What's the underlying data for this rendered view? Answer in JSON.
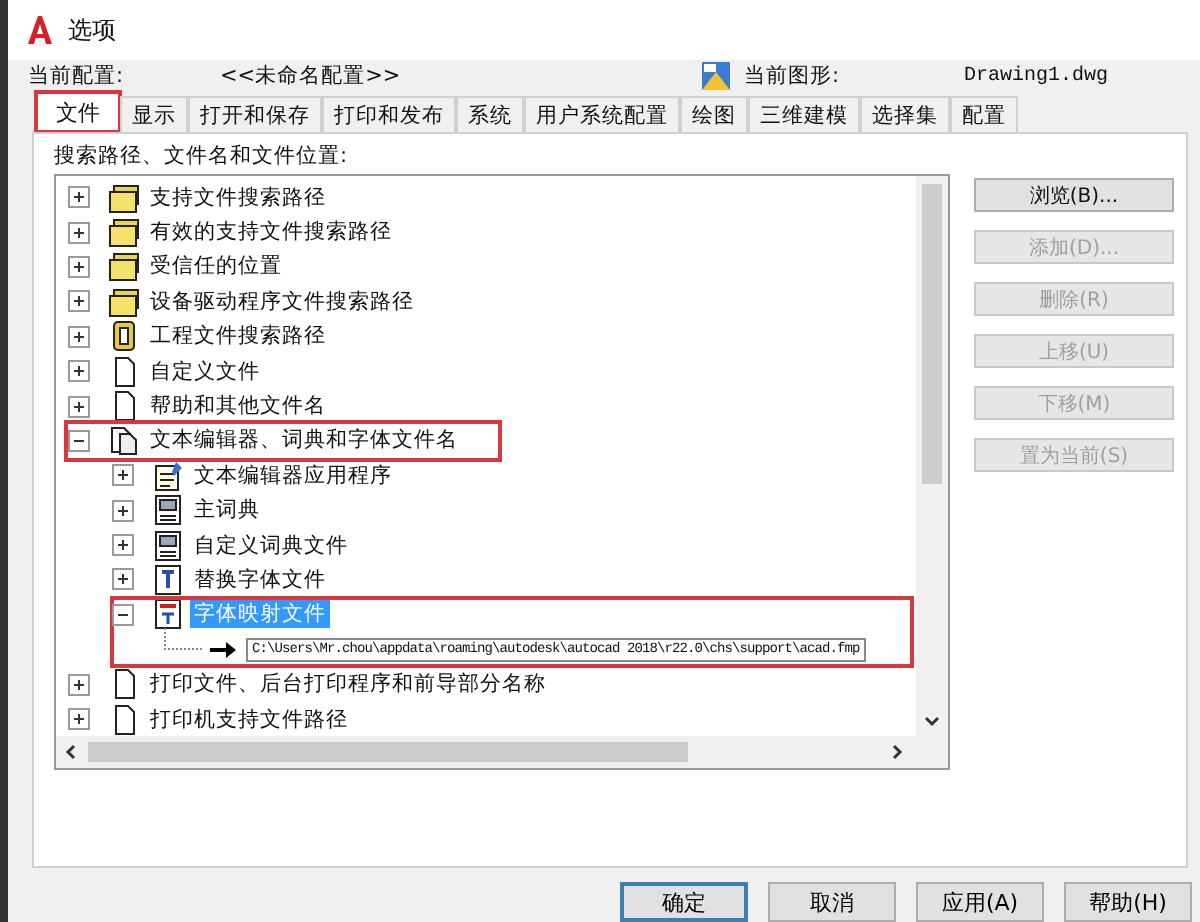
{
  "window": {
    "title": "选项"
  },
  "profile": {
    "label": "当前配置:",
    "value": "<<未命名配置>>",
    "drawing_label": "当前图形:",
    "drawing_value": "Drawing1.dwg"
  },
  "tabs": [
    {
      "label": "文件",
      "selected": true,
      "highlighted": true
    },
    {
      "label": "显示",
      "selected": false,
      "highlighted": false
    },
    {
      "label": "打开和保存",
      "selected": false,
      "highlighted": false
    },
    {
      "label": "打印和发布",
      "selected": false,
      "highlighted": false
    },
    {
      "label": "系统",
      "selected": false,
      "highlighted": false
    },
    {
      "label": "用户系统配置",
      "selected": false,
      "highlighted": false
    },
    {
      "label": "绘图",
      "selected": false,
      "highlighted": false
    },
    {
      "label": "三维建模",
      "selected": false,
      "highlighted": false
    },
    {
      "label": "选择集",
      "selected": false,
      "highlighted": false
    },
    {
      "label": "配置",
      "selected": false,
      "highlighted": false
    }
  ],
  "tree_label": "搜索路径、文件名和文件位置:",
  "tree": [
    {
      "label": "支持文件搜索路径",
      "kind": "folders",
      "expanded": false,
      "selected": false,
      "highlighted": false
    },
    {
      "label": "有效的支持文件搜索路径",
      "kind": "folders",
      "expanded": false,
      "selected": false,
      "highlighted": false
    },
    {
      "label": "受信任的位置",
      "kind": "folders",
      "expanded": false,
      "selected": false,
      "highlighted": false
    },
    {
      "label": "设备驱动程序文件搜索路径",
      "kind": "folders",
      "expanded": false,
      "selected": false,
      "highlighted": false
    },
    {
      "label": "工程文件搜索路径",
      "kind": "project",
      "expanded": false,
      "selected": false,
      "highlighted": false
    },
    {
      "label": "自定义文件",
      "kind": "file",
      "expanded": false,
      "selected": false,
      "highlighted": false
    },
    {
      "label": "帮助和其他文件名",
      "kind": "file",
      "expanded": false,
      "selected": false,
      "highlighted": false
    },
    {
      "label": "文本编辑器、词典和字体文件名",
      "kind": "files",
      "expanded": true,
      "selected": false,
      "highlighted": true,
      "children": [
        {
          "label": "文本编辑器应用程序",
          "kind": "editor",
          "expanded": false,
          "selected": false,
          "highlighted": false
        },
        {
          "label": "主词典",
          "kind": "dictionary",
          "expanded": false,
          "selected": false,
          "highlighted": false
        },
        {
          "label": "自定义词典文件",
          "kind": "dictionary",
          "expanded": false,
          "selected": false,
          "highlighted": false
        },
        {
          "label": "替换字体文件",
          "kind": "font",
          "expanded": false,
          "selected": false,
          "highlighted": false
        },
        {
          "label": "字体映射文件",
          "kind": "fontmap",
          "expanded": true,
          "selected": true,
          "highlighted": true,
          "children": [
            {
              "label": "C:\\Users\\Mr.chou\\appdata\\roaming\\autodesk\\autocad 2018\\r22.0\\chs\\support\\acad.fmp",
              "kind": "path",
              "selected": false,
              "highlighted": false
            }
          ]
        }
      ]
    },
    {
      "label": "打印文件、后台打印程序和前导部分名称",
      "kind": "file",
      "expanded": false,
      "selected": false,
      "highlighted": false
    },
    {
      "label": "打印机支持文件路径",
      "kind": "file",
      "expanded": false,
      "selected": false,
      "highlighted": false
    }
  ],
  "side_buttons": [
    {
      "label": "浏览(B)...",
      "disabled": false
    },
    {
      "label": "添加(D)...",
      "disabled": true
    },
    {
      "label": "删除(R)",
      "disabled": true
    },
    {
      "label": "上移(U)",
      "disabled": true
    },
    {
      "label": "下移(M)",
      "disabled": true
    },
    {
      "label": "置为当前(S)",
      "disabled": true
    }
  ],
  "footer_buttons": [
    {
      "label": "确定",
      "default": true
    },
    {
      "label": "取消",
      "default": false
    },
    {
      "label": "应用(A)",
      "default": false
    },
    {
      "label": "帮助(H)",
      "default": false
    }
  ]
}
